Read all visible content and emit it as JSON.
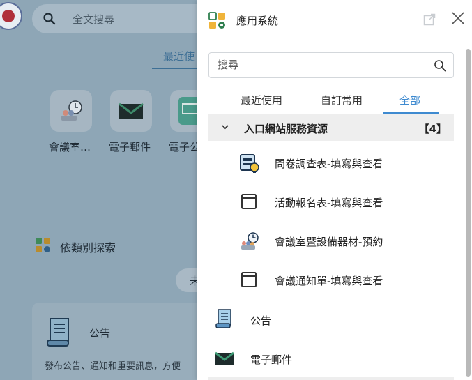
{
  "background": {
    "search_placeholder": "全文搜尋",
    "tab_recent": "最近使",
    "apps": [
      {
        "label": "會議室…",
        "icon": "meeting-room-icon"
      },
      {
        "label": "電子郵件",
        "icon": "email-icon"
      },
      {
        "label": "電子公",
        "icon": "monitor-icon"
      }
    ],
    "category_title": "依類別探索",
    "pill_label": "未",
    "card": {
      "title": "公告",
      "description": "發布公告、通知和重要訊息，方便"
    }
  },
  "panel": {
    "title": "應用系統",
    "search": {
      "placeholder": "搜尋",
      "value": ""
    },
    "tabs": [
      {
        "label": "最近使用",
        "active": false
      },
      {
        "label": "自訂常用",
        "active": false
      },
      {
        "label": "全部",
        "active": true
      }
    ],
    "section": {
      "title": "入口網站服務資源",
      "count": "【4】",
      "items": [
        {
          "label": "問卷調查表-填寫與查看",
          "icon": "survey-icon"
        },
        {
          "label": "活動報名表-填寫與查看",
          "icon": "window-icon"
        },
        {
          "label": "會議室暨設備器材-預約",
          "icon": "meeting-room-icon"
        },
        {
          "label": "會議通知單-填寫與查看",
          "icon": "window-icon"
        }
      ]
    },
    "items": [
      {
        "label": "公告",
        "icon": "announcement-scroll-icon"
      },
      {
        "label": "電子郵件",
        "icon": "email-icon"
      }
    ],
    "colors": {
      "accent": "#3e8ad0",
      "section_bg": "#eeeeee"
    }
  }
}
